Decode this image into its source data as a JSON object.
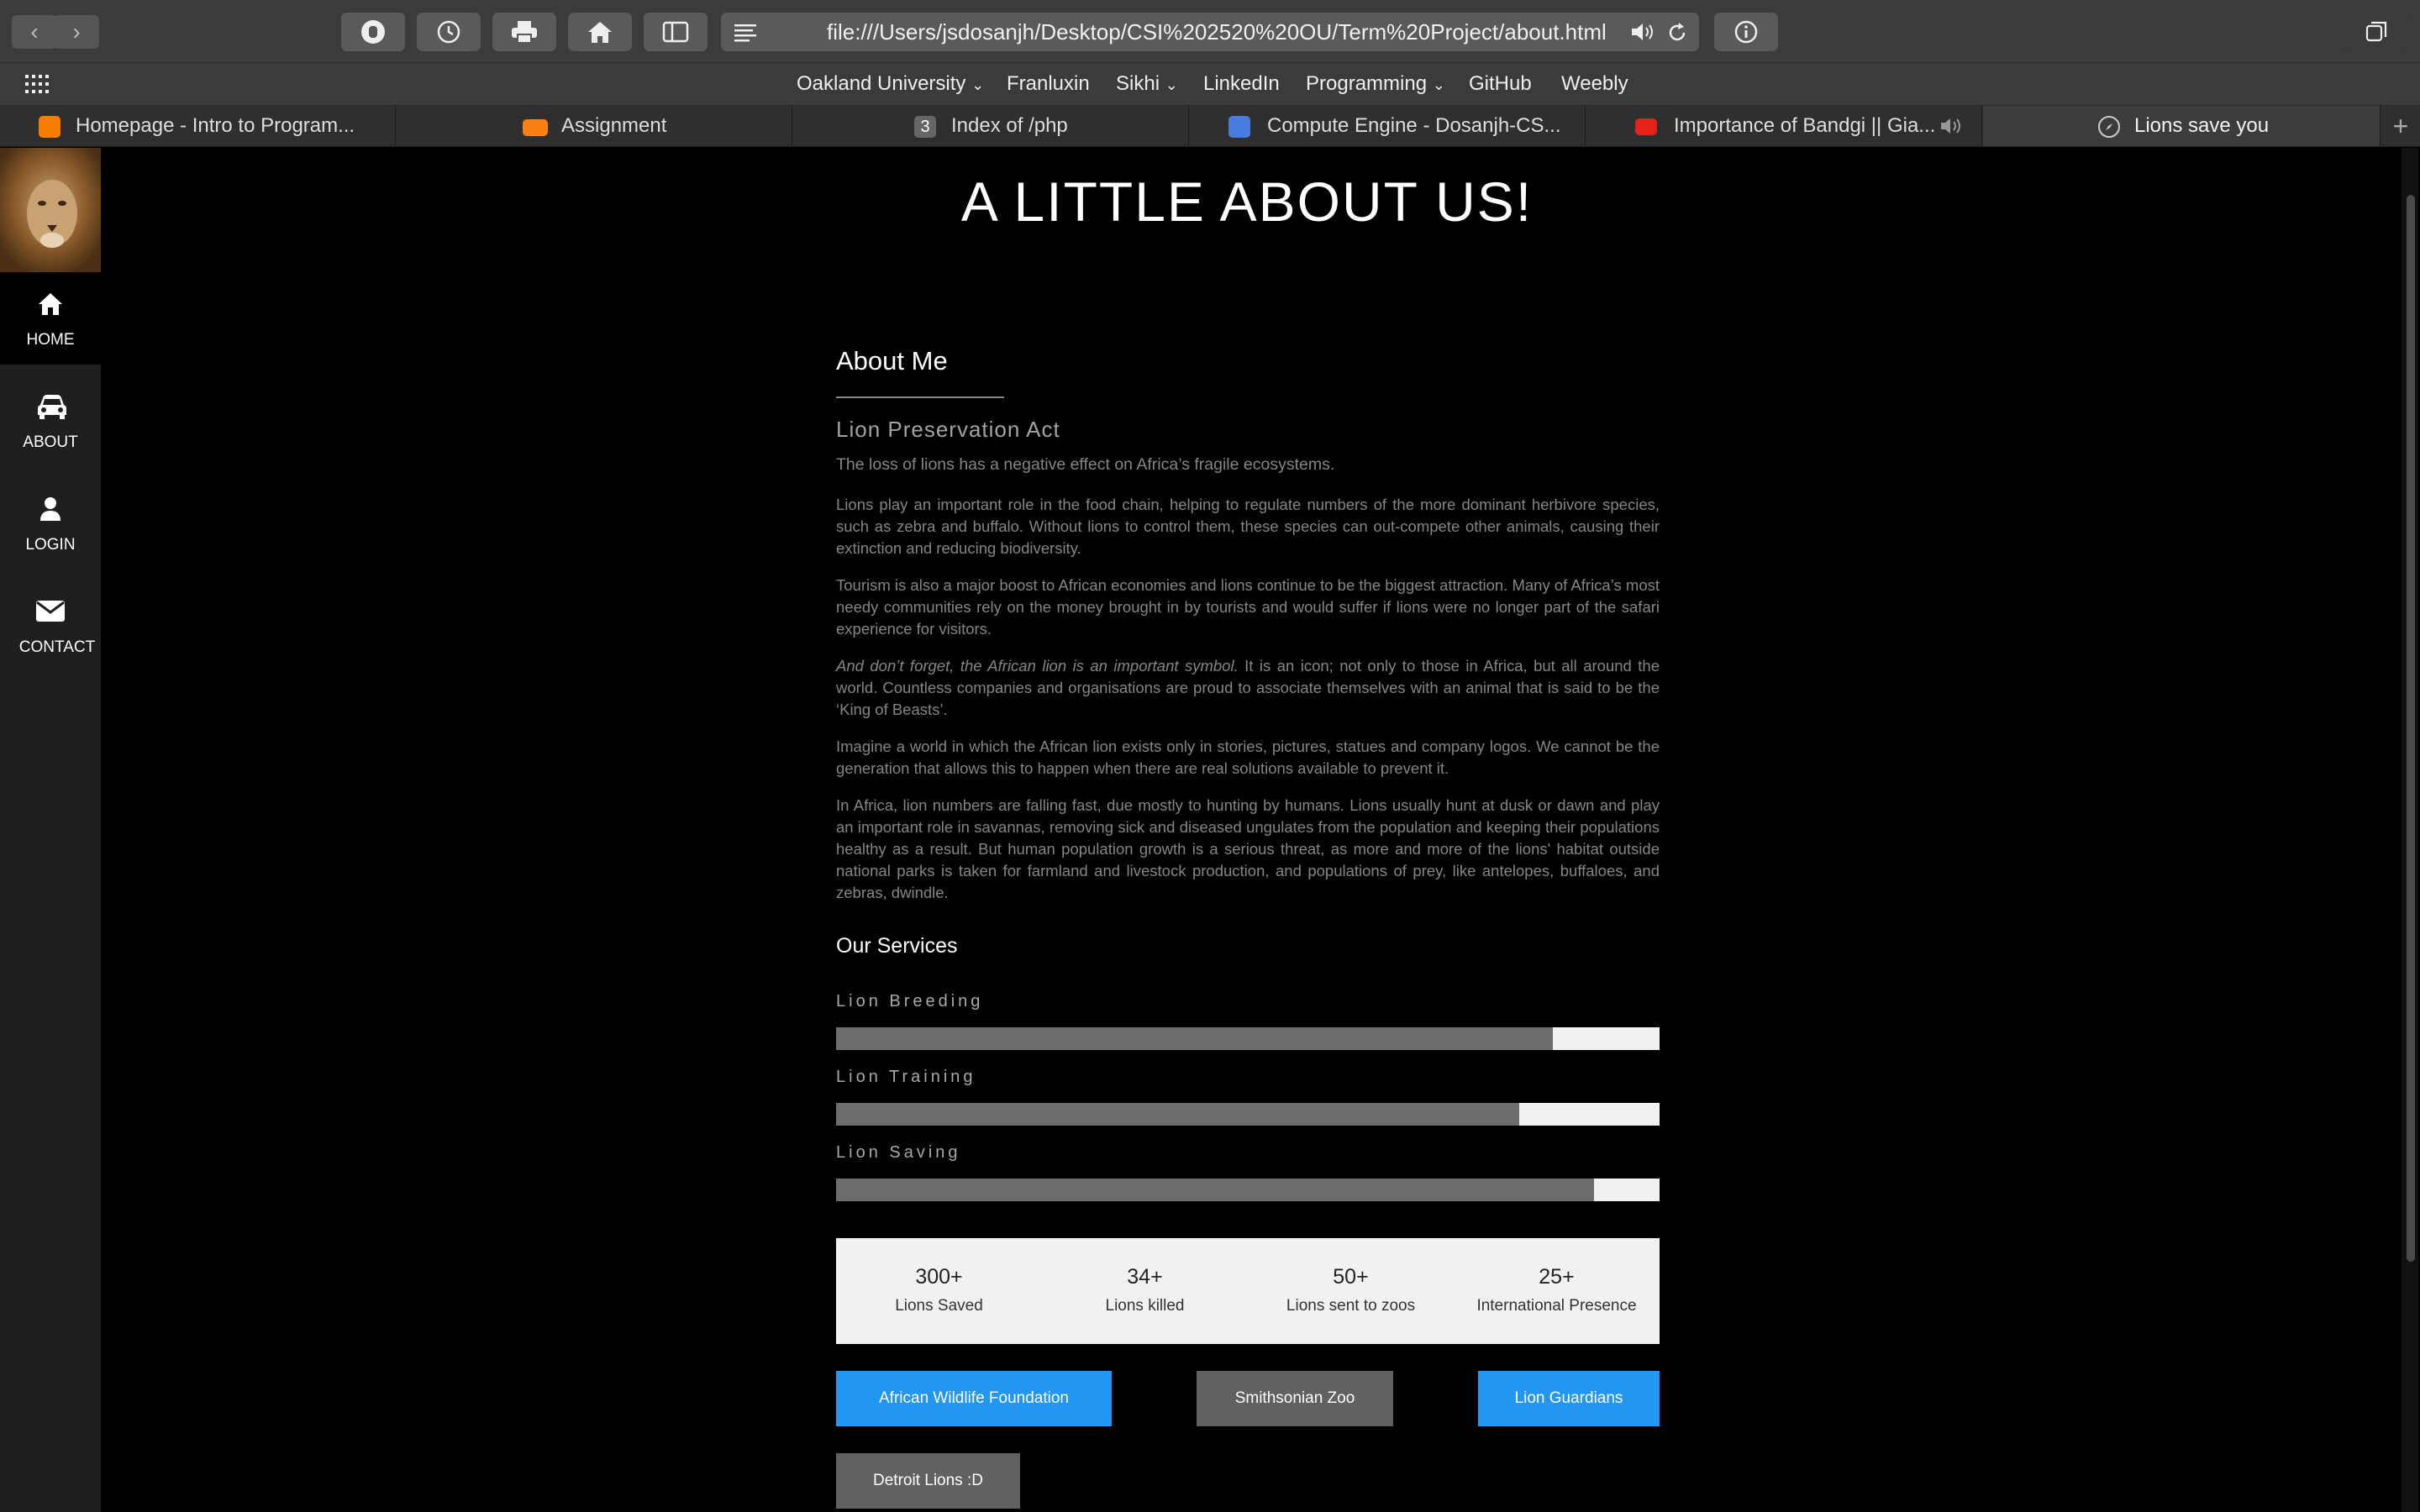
{
  "browser": {
    "url": "file:///Users/jsdosanjh/Desktop/CSI%202520%20OU/Term%20Project/about.html",
    "bookmarks": [
      "Oakland University",
      "Franluxin",
      "Sikhi",
      "LinkedIn",
      "Programming",
      "GitHub",
      "Weebly"
    ],
    "tabs": [
      {
        "label": "Homepage - Intro to Program...",
        "icon": "blogger-icon",
        "active": false
      },
      {
        "label": "Assignment",
        "icon": "moodle-icon",
        "active": false
      },
      {
        "label": "Index of /php",
        "icon": "number-3-icon",
        "badge": "3",
        "active": false
      },
      {
        "label": "Compute Engine - Dosanjh-CS...",
        "icon": "chip-icon",
        "active": false
      },
      {
        "label": "Importance of Bandgi || Gia...",
        "icon": "youtube-icon",
        "active": false
      },
      {
        "label": "Lions save you",
        "icon": "compass-icon",
        "active": true
      }
    ]
  },
  "sidebar": {
    "items": [
      {
        "label": "HOME",
        "icon": "home-icon"
      },
      {
        "label": "ABOUT",
        "icon": "car-icon"
      },
      {
        "label": "LOGIN",
        "icon": "user-icon"
      },
      {
        "label": "CONTACT",
        "icon": "envelope-icon"
      }
    ]
  },
  "page": {
    "title": "A LITTLE ABOUT US!",
    "about_heading": "About Me",
    "subheading": "Lion Preservation Act",
    "lead": "The loss of lions has a negative effect on Africa’s fragile ecosystems.",
    "paragraphs": [
      "Lions play an important role in the food chain, helping to regulate numbers of the more dominant herbivore species, such as zebra and buffalo. Without lions to control them, these species can out-compete other animals, causing their extinction and reducing biodiversity.",
      "Tourism is also a major boost to African economies and lions continue to be the biggest attraction. Many of Africa’s most needy communities rely on the money brought in by tourists and would suffer if lions were no longer part of the safari experience for visitors.",
      "It is an icon; not only to those in Africa, but all around the world. Countless companies and organisations are proud to associate themselves with an animal that is said to be the ‘King of Beasts’.",
      "Imagine a world in which the African lion exists only in stories, pictures, statues and company logos. We cannot be the generation that allows this to happen when there are real solutions available to prevent it.",
      "In Africa, lion numbers are falling fast, due mostly to hunting by humans. Lions usually hunt at dusk or dawn and play an important role in savannas, removing sick and diseased ungulates from the population and keeping their populations healthy as a result. But human population growth is a serious threat, as more and more of the lions' habitat outside national parks is taken for farmland and livestock production, and populations of prey, like antelopes, buffaloes, and zebras, dwindle."
    ],
    "italic_lead": "And don’t forget, the African lion is an important symbol.",
    "services_heading": "Our Services",
    "skills": [
      {
        "label": "Lion Breeding",
        "level": 0.87
      },
      {
        "label": "Lion Training",
        "level": 0.83
      },
      {
        "label": "Lion Saving",
        "level": 0.92
      }
    ],
    "stats": [
      {
        "value": "300+",
        "caption": "Lions Saved"
      },
      {
        "value": "34+",
        "caption": "Lions killed"
      },
      {
        "value": "50+",
        "caption": "Lions sent to zoos"
      },
      {
        "value": "25+",
        "caption": "International Presence"
      }
    ],
    "links": [
      {
        "label": "African Wildlife Foundation",
        "color": "#2196f3"
      },
      {
        "label": "Smithsonian Zoo",
        "color": "#616161"
      },
      {
        "label": "Lion Guardians",
        "color": "#2196f3"
      },
      {
        "label": "Detroit Lions :D",
        "color": "#616161"
      }
    ]
  },
  "colors": {
    "background": "#000000",
    "sidebar": "#1f1f1f",
    "accent": "#2196f3"
  }
}
